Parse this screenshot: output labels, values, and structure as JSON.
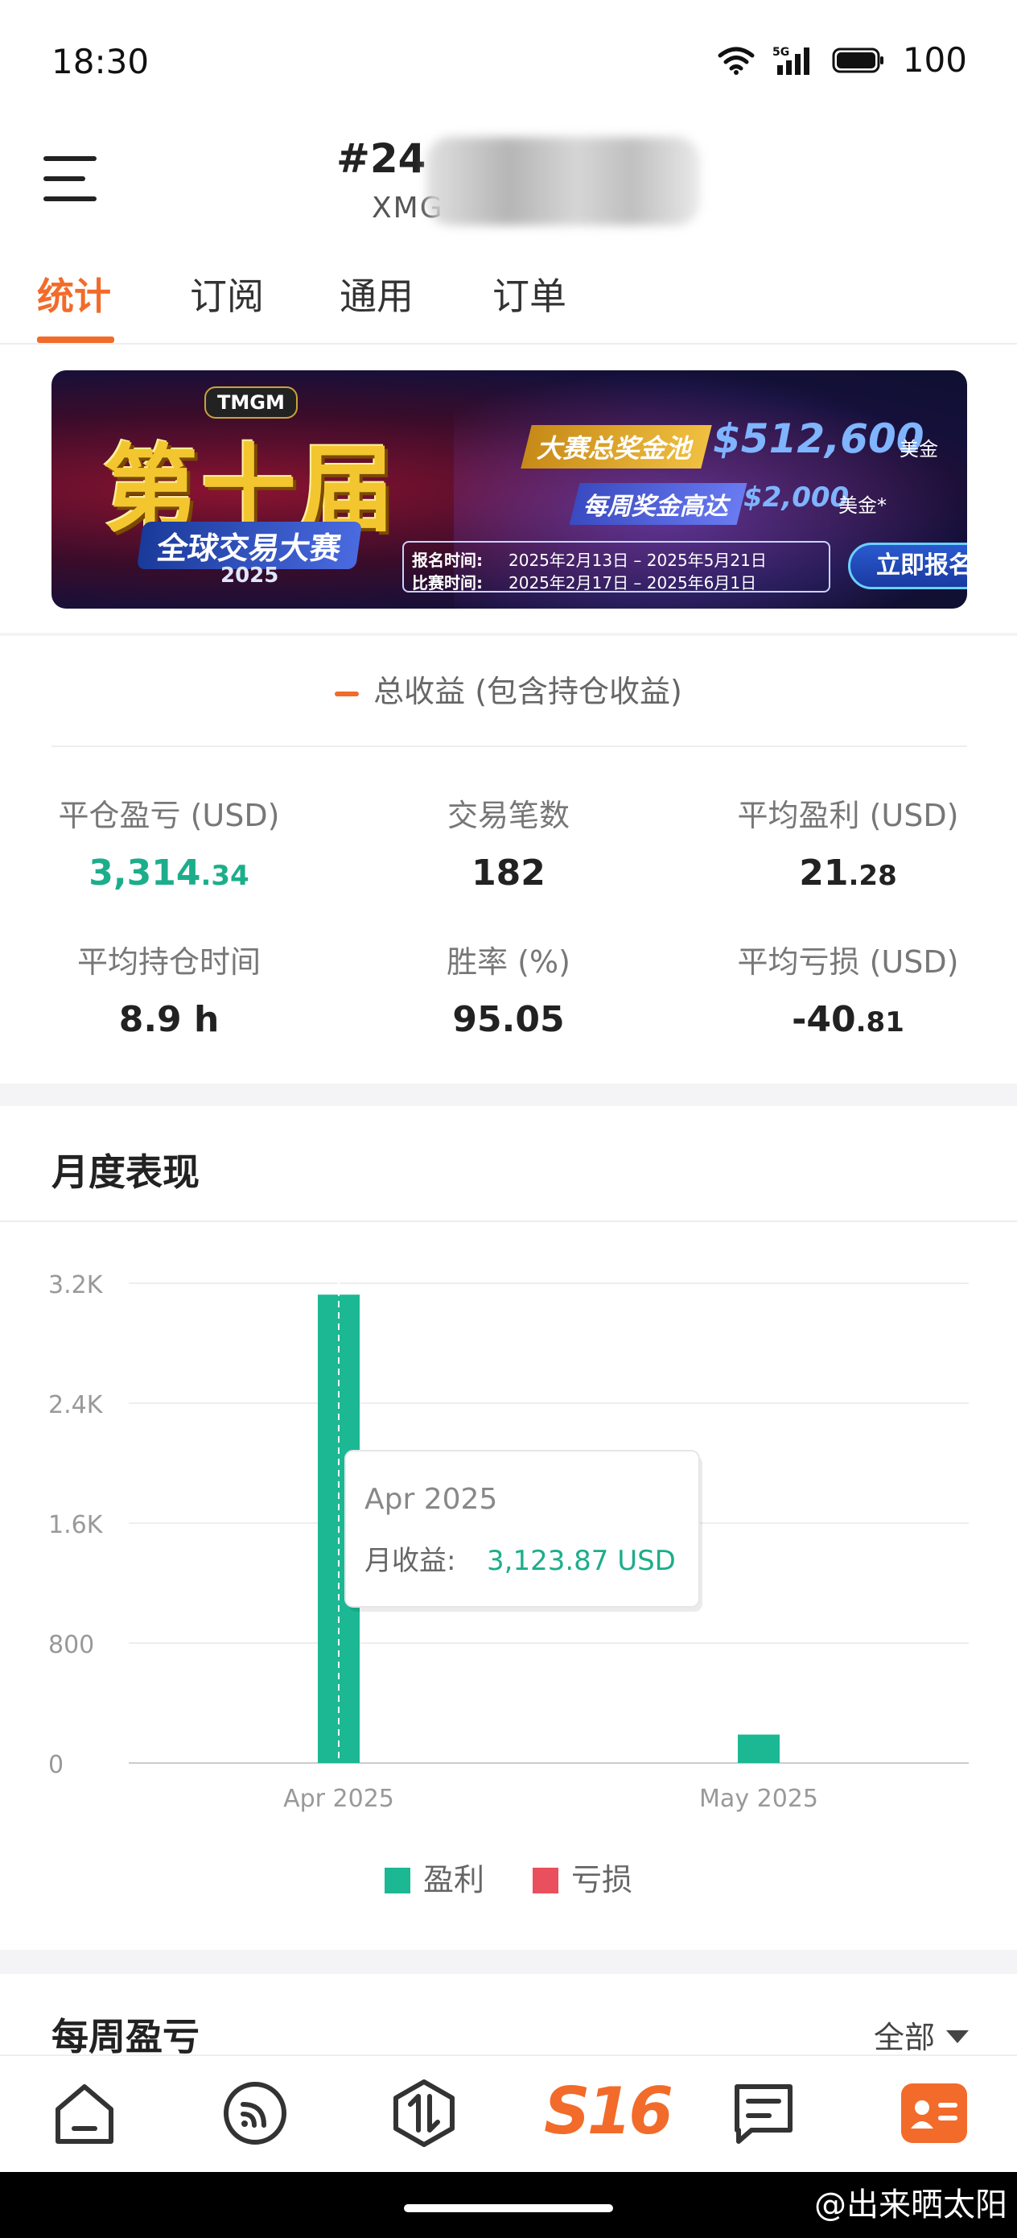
{
  "status_bar": {
    "time": "18:30",
    "battery": "100",
    "network": "5G"
  },
  "header": {
    "title": "#24",
    "subtitle": "XMG"
  },
  "tabs": [
    {
      "label": "统计",
      "active": true
    },
    {
      "label": "订阅",
      "active": false
    },
    {
      "label": "通用",
      "active": false
    },
    {
      "label": "订单",
      "active": false
    }
  ],
  "banner": {
    "logo": "TMGM",
    "headline": "第十届",
    "subhead": "全球交易大赛",
    "year": "2025",
    "pool_label": "大赛总奖金池",
    "pool_value": "$512,600",
    "pool_unit": "美金",
    "weekly_label": "每周奖金高达",
    "weekly_value": "$2,000",
    "weekly_unit": "美金*",
    "reg_key": "报名时间:",
    "reg_val": "2025年2月13日 – 2025年5月21日",
    "comp_key": "比赛时间:",
    "comp_val": "2025年2月17日 – 2025年6月1日",
    "cta": "立即报名"
  },
  "total_legend": "总收益 (包含持仓收益)",
  "stats": [
    {
      "label": "平仓盈亏 (USD)",
      "int": "3,314",
      "dec": ".34",
      "color": "green"
    },
    {
      "label": "交易笔数",
      "int": "182",
      "dec": "",
      "color": "default"
    },
    {
      "label": "平均盈利 (USD)",
      "int": "21",
      "dec": ".28",
      "color": "default"
    },
    {
      "label": "平均持仓时间",
      "int": "8.9 h",
      "dec": "",
      "color": "default"
    },
    {
      "label": "胜率 (%)",
      "int": "95.05",
      "dec": "",
      "color": "default"
    },
    {
      "label": "平均亏损 (USD)",
      "int": "-40",
      "dec": ".81",
      "color": "default"
    }
  ],
  "monthly": {
    "title": "月度表现"
  },
  "chart_data": {
    "type": "bar",
    "categories": [
      "Apr 2025",
      "May 2025"
    ],
    "series": [
      {
        "name": "盈利",
        "values": [
          3123.87,
          190
        ],
        "color": "#1cb894"
      },
      {
        "name": "亏损",
        "values": [
          0,
          0
        ],
        "color": "#ea4f5e"
      }
    ],
    "yticks": [
      "3.2K",
      "2.4K",
      "1.6K",
      "800",
      "0"
    ],
    "ytick_values": [
      3200,
      2400,
      1600,
      800,
      0
    ],
    "ylim": [
      0,
      3200
    ],
    "grid": true,
    "legend": "bottom-center",
    "tooltip": {
      "title": "Apr 2025",
      "label": "月收益:",
      "value": "3,123.87 USD",
      "category": "Apr 2025"
    }
  },
  "weekly": {
    "title": "每周盈亏",
    "filter": "全部"
  },
  "nav": [
    {
      "name": "home"
    },
    {
      "name": "feed"
    },
    {
      "name": "trade"
    },
    {
      "name": "s16",
      "label": "S16"
    },
    {
      "name": "news"
    },
    {
      "name": "profile"
    }
  ],
  "watermark": "@出来晒太阳"
}
